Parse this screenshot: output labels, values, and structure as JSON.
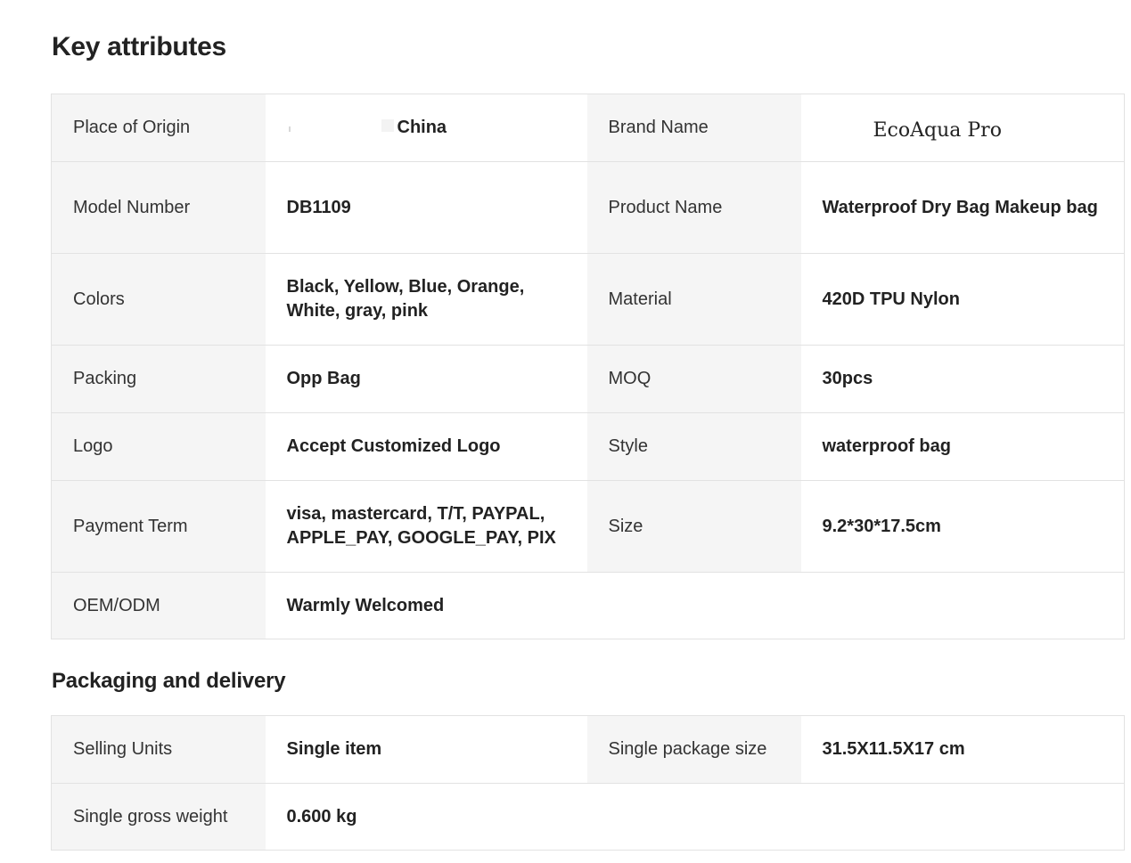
{
  "key_attributes": {
    "title": "Key attributes",
    "rows": [
      {
        "label1": "Place of Origin",
        "value1": "China",
        "label2": "Brand Name",
        "value2": "EcoAqua Pro"
      },
      {
        "label1": "Model Number",
        "value1": "DB1109",
        "label2": "Product Name",
        "value2": "Waterproof Dry Bag Makeup bag"
      },
      {
        "label1": "Colors",
        "value1": "Black, Yellow, Blue, Orange, White, gray, pink",
        "label2": "Material",
        "value2": "420D TPU Nylon"
      },
      {
        "label1": "Packing",
        "value1": "Opp Bag",
        "label2": "MOQ",
        "value2": "30pcs"
      },
      {
        "label1": "Logo",
        "value1": "Accept Customized Logo",
        "label2": "Style",
        "value2": "waterproof bag"
      },
      {
        "label1": "Payment Term",
        "value1": "visa, mastercard, T/T, PAYPAL, APPLE_PAY, GOOGLE_PAY, PIX",
        "label2": "Size",
        "value2": "9.2*30*17.5cm"
      },
      {
        "label1": "OEM/ODM",
        "value1": "Warmly Welcomed"
      }
    ]
  },
  "packaging_delivery": {
    "title": "Packaging and delivery",
    "rows": [
      {
        "label1": "Selling Units",
        "value1": "Single item",
        "label2": "Single package size",
        "value2": "31.5X11.5X17 cm"
      },
      {
        "label1": "Single gross weight",
        "value1": "0.600 kg"
      }
    ]
  }
}
